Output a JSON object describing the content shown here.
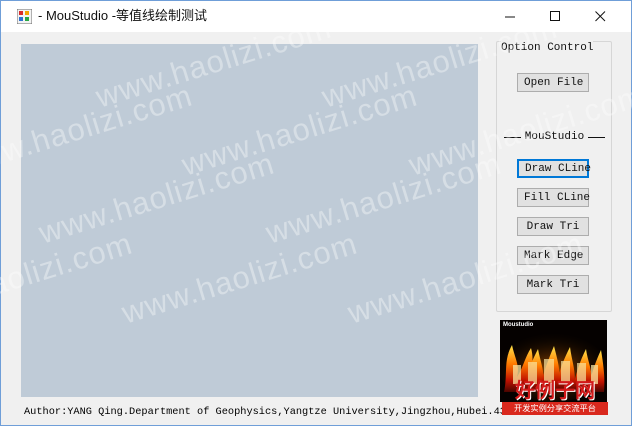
{
  "window": {
    "title": "- MouStudio -等值线绘制测试"
  },
  "controls": {
    "group_label": "Option Control",
    "open_file": "Open File",
    "section_label": "MouStudio",
    "draw_cline": "Draw CLine",
    "fill_cline": "Fill CLine",
    "draw_tri": "Draw Tri",
    "mark_edge": "Mark Edge",
    "mark_tri": "Mark Tri"
  },
  "logo": {
    "caption": "Moustudio",
    "title": "MouStudio"
  },
  "status": {
    "author": "Author:YANG Qing.Department of Geophysics,Yangtze University,Jingzhou,Hubei.434023"
  },
  "watermarks": [
    "www.haolizi.com",
    "www.haolizi.com",
    "www.haolizi.com",
    "www.haolizi.com",
    "www.haolizi.com",
    "www.haolizi.com",
    "www.haolizi.com",
    "www.haolizi.com",
    "www.haolizi.com",
    "www.haolizi.com"
  ],
  "corner_watermark": {
    "main": "好例子网",
    "sub": "开发实例分享交流平台"
  },
  "colors": {
    "canvas_background": "#bfcbd7",
    "window_border": "#6f9ed8",
    "focused_button_border": "#0078d7",
    "watermark_red": "#d9291e"
  }
}
